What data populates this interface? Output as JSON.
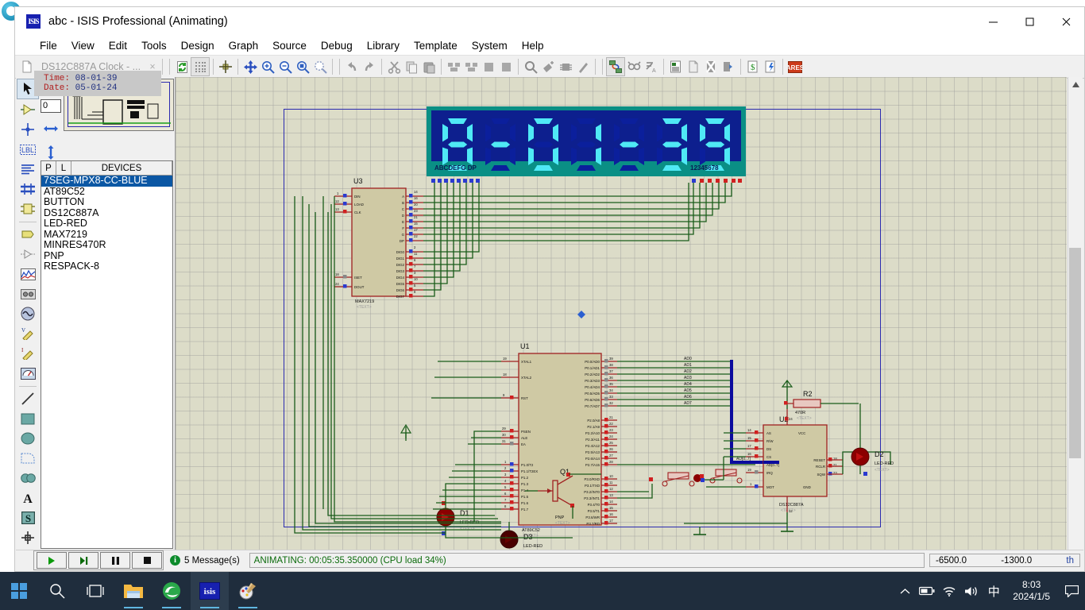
{
  "window": {
    "title": "abc - ISIS Professional (Animating)",
    "app_icon": "isis-logo-icon",
    "minimize": "─",
    "maximize": "□",
    "close": "✕"
  },
  "menubar": {
    "items": [
      "File",
      "View",
      "Edit",
      "Tools",
      "Design",
      "Graph",
      "Source",
      "Debug",
      "Library",
      "Template",
      "System",
      "Help"
    ]
  },
  "toolbar": {
    "tab_label": "DS12C887A Clock - ...",
    "tab_close": "×",
    "buttons": [
      "refresh-icon",
      "grid-icon",
      "origin-icon",
      "pan-icon",
      "zoom-in-icon",
      "zoom-out-icon",
      "zoom-area-icon",
      "zoom-select-icon",
      "undo-icon",
      "redo-icon",
      "cut-icon",
      "copy-icon",
      "paste-icon",
      "block-copy-icon",
      "block-move-icon",
      "block-delete-icon",
      "pick-device-icon",
      "make-device-icon",
      "packaging-icon",
      "decompose-icon",
      "wire-autorouter-icon",
      "search-tag-icon",
      "property-assign-icon",
      "design-explorer-icon",
      "new-sheet-icon",
      "remove-sheet-icon",
      "exit-sheet-icon",
      "bill-of-materials-icon",
      "electrical-rules-icon",
      "netlist-ares-icon"
    ]
  },
  "tools": {
    "items": [
      {
        "name": "selection-mode-tool",
        "selected": true
      },
      {
        "name": "component-mode-tool",
        "selected": false
      },
      {
        "name": "junction-dot-tool",
        "selected": false
      },
      {
        "name": "wire-label-tool",
        "selected": false
      },
      {
        "name": "text-script-tool",
        "selected": false
      },
      {
        "name": "bus-tool",
        "selected": false
      },
      {
        "name": "subcircuit-tool",
        "selected": false
      },
      {
        "name": "terminals-tool",
        "selected": false
      },
      {
        "name": "device-pins-tool",
        "selected": false
      },
      {
        "name": "graph-tool",
        "selected": false
      },
      {
        "name": "tape-recorder-tool",
        "selected": false
      },
      {
        "name": "generator-tool",
        "selected": false
      },
      {
        "name": "voltage-probe-tool",
        "selected": false
      },
      {
        "name": "current-probe-tool",
        "selected": false
      },
      {
        "name": "virtual-instrument-tool",
        "selected": false
      },
      {
        "name": "line-tool",
        "selected": false
      },
      {
        "name": "box-tool",
        "selected": false
      },
      {
        "name": "circle-tool",
        "selected": false
      },
      {
        "name": "arc-tool",
        "selected": false
      },
      {
        "name": "path-tool",
        "selected": false
      },
      {
        "name": "text-tool",
        "selected": false
      },
      {
        "name": "symbol-tool",
        "selected": false
      },
      {
        "name": "marker-tool",
        "selected": false
      }
    ]
  },
  "sidebar": {
    "rotation_value": "0",
    "rotate_icon": "rotate-icon",
    "mirror_x_icon": "mirror-horizontal-icon",
    "mirror_y_icon": "mirror-vertical-icon",
    "devices_header": {
      "p": "P",
      "l": "L",
      "title": "DEVICES"
    },
    "devices": [
      {
        "label": "7SEG-MPX8-CC-BLUE",
        "selected": true
      },
      {
        "label": "AT89C52",
        "selected": false
      },
      {
        "label": "BUTTON",
        "selected": false
      },
      {
        "label": "DS12C887A",
        "selected": false
      },
      {
        "label": "LED-RED",
        "selected": false
      },
      {
        "label": "MAX7219",
        "selected": false
      },
      {
        "label": "MINRES470R",
        "selected": false
      },
      {
        "label": "PNP",
        "selected": false
      },
      {
        "label": "RESPACK-8",
        "selected": false
      }
    ]
  },
  "tooltip": {
    "time_key": "Time: ",
    "time_value": "08-01-39",
    "date_key": "Date: ",
    "date_value": "05-01-24"
  },
  "schematic": {
    "display": {
      "reference": "",
      "segments_label": "ABCDEFG DP",
      "digits_label": "12345678",
      "digits": [
        "8",
        "-",
        "0",
        "1",
        "-",
        "3",
        "9"
      ],
      "on_color": "#4fe9f5",
      "off_color": "#0b1f9c",
      "panel_color": "#0d1f8e",
      "bezel_color": "#0a8f85"
    },
    "components": [
      {
        "ref": "U3",
        "value": "MAX7219",
        "status": "<TEXT>",
        "left_pins": [
          "DIN",
          "LOAD",
          "CLK",
          "ISET",
          "DOUT"
        ],
        "right_pins": [
          "A",
          "B",
          "C",
          "D",
          "E",
          "F",
          "G",
          "DP",
          "DIG0",
          "DIG1",
          "DIG2",
          "DIG3",
          "DIG4",
          "DIG5",
          "DIG6",
          "DIG7"
        ]
      },
      {
        "ref": "U1",
        "value": "AT89C52",
        "status": "<TEXT>",
        "left_pins": [
          "XTAL1",
          "XTAL2",
          "RST",
          "PSEN",
          "ALE",
          "EA",
          "P1.0/T2",
          "P1.1/T2EX",
          "P1.2",
          "P1.3",
          "P1.4",
          "P1.5",
          "P1.6",
          "P1.7"
        ],
        "right_pins": [
          "P0.0/AD0",
          "P0.1/AD1",
          "P0.2/AD2",
          "P0.3/AD3",
          "P0.4/AD4",
          "P0.5/AD5",
          "P0.6/AD6",
          "P0.7/AD7",
          "P2.0/A8",
          "P2.1/A9",
          "P2.2/A10",
          "P2.3/A11",
          "P2.4/A12",
          "P2.5/A13",
          "P2.6/A14",
          "P2.7/A15",
          "P3.0/RXD",
          "P3.1/TXD",
          "P3.2/INT0",
          "P3.3/INT1",
          "P3.4/T0",
          "P3.5/T1",
          "P3.6/WR",
          "P3.7/RD"
        ]
      },
      {
        "ref": "U2",
        "value": "DS12C887A",
        "status": "<TEXT>",
        "left_pins": [
          "AS",
          "R/W",
          "DS",
          "CS",
          "AD[0..7]",
          "IRQ",
          "MOT"
        ],
        "right_pins": [
          "VCC",
          "RESET",
          "RCLR",
          "SQW",
          "GND"
        ]
      },
      {
        "ref": "R2",
        "value": "470R",
        "status": "<TEXT>"
      },
      {
        "ref": "D1",
        "value": "LED-RED",
        "status": "<TEXT>"
      },
      {
        "ref": "D2",
        "value": "LED-RED",
        "status": "<TEXT>"
      },
      {
        "ref": "D3",
        "value": "LED-RED",
        "status": "<TEXT>"
      },
      {
        "ref": "Q1",
        "value": "PNP",
        "status": "<TEXT>"
      }
    ],
    "bus_label": "AD[0..7]",
    "net_labels": [
      "AD0",
      "AD1",
      "AD2",
      "AD3",
      "AD4",
      "AD5",
      "AD6",
      "AD7"
    ]
  },
  "statusbar": {
    "play_icon": "play-icon",
    "step_icon": "step-icon",
    "pause_icon": "pause-icon",
    "stop_icon": "stop-icon",
    "message_count": "5 Message(s)",
    "animation_status": "ANIMATING: 00:05:35.350000 (CPU load 34%)",
    "coord_x": "-6500.0",
    "coord_y": "-1300.0",
    "coord_unit": "th"
  },
  "taskbar": {
    "start_icon": "windows-start-icon",
    "items": [
      {
        "name": "search-icon",
        "active": false
      },
      {
        "name": "task-view-icon",
        "active": false
      },
      {
        "name": "file-explorer-icon",
        "active": false,
        "running": true
      },
      {
        "name": "edge-browser-icon",
        "active": false,
        "running": true
      },
      {
        "name": "isis-app-icon",
        "active": true,
        "running": true,
        "label": "isis"
      },
      {
        "name": "paint-icon",
        "active": false,
        "running": true
      }
    ],
    "tray": [
      "show-hidden-icons-icon",
      "battery-icon",
      "wifi-icon",
      "volume-icon"
    ],
    "ime_label": "中",
    "clock_time": "8:03",
    "clock_date": "2024/1/5",
    "notification_icon": "action-center-icon"
  }
}
